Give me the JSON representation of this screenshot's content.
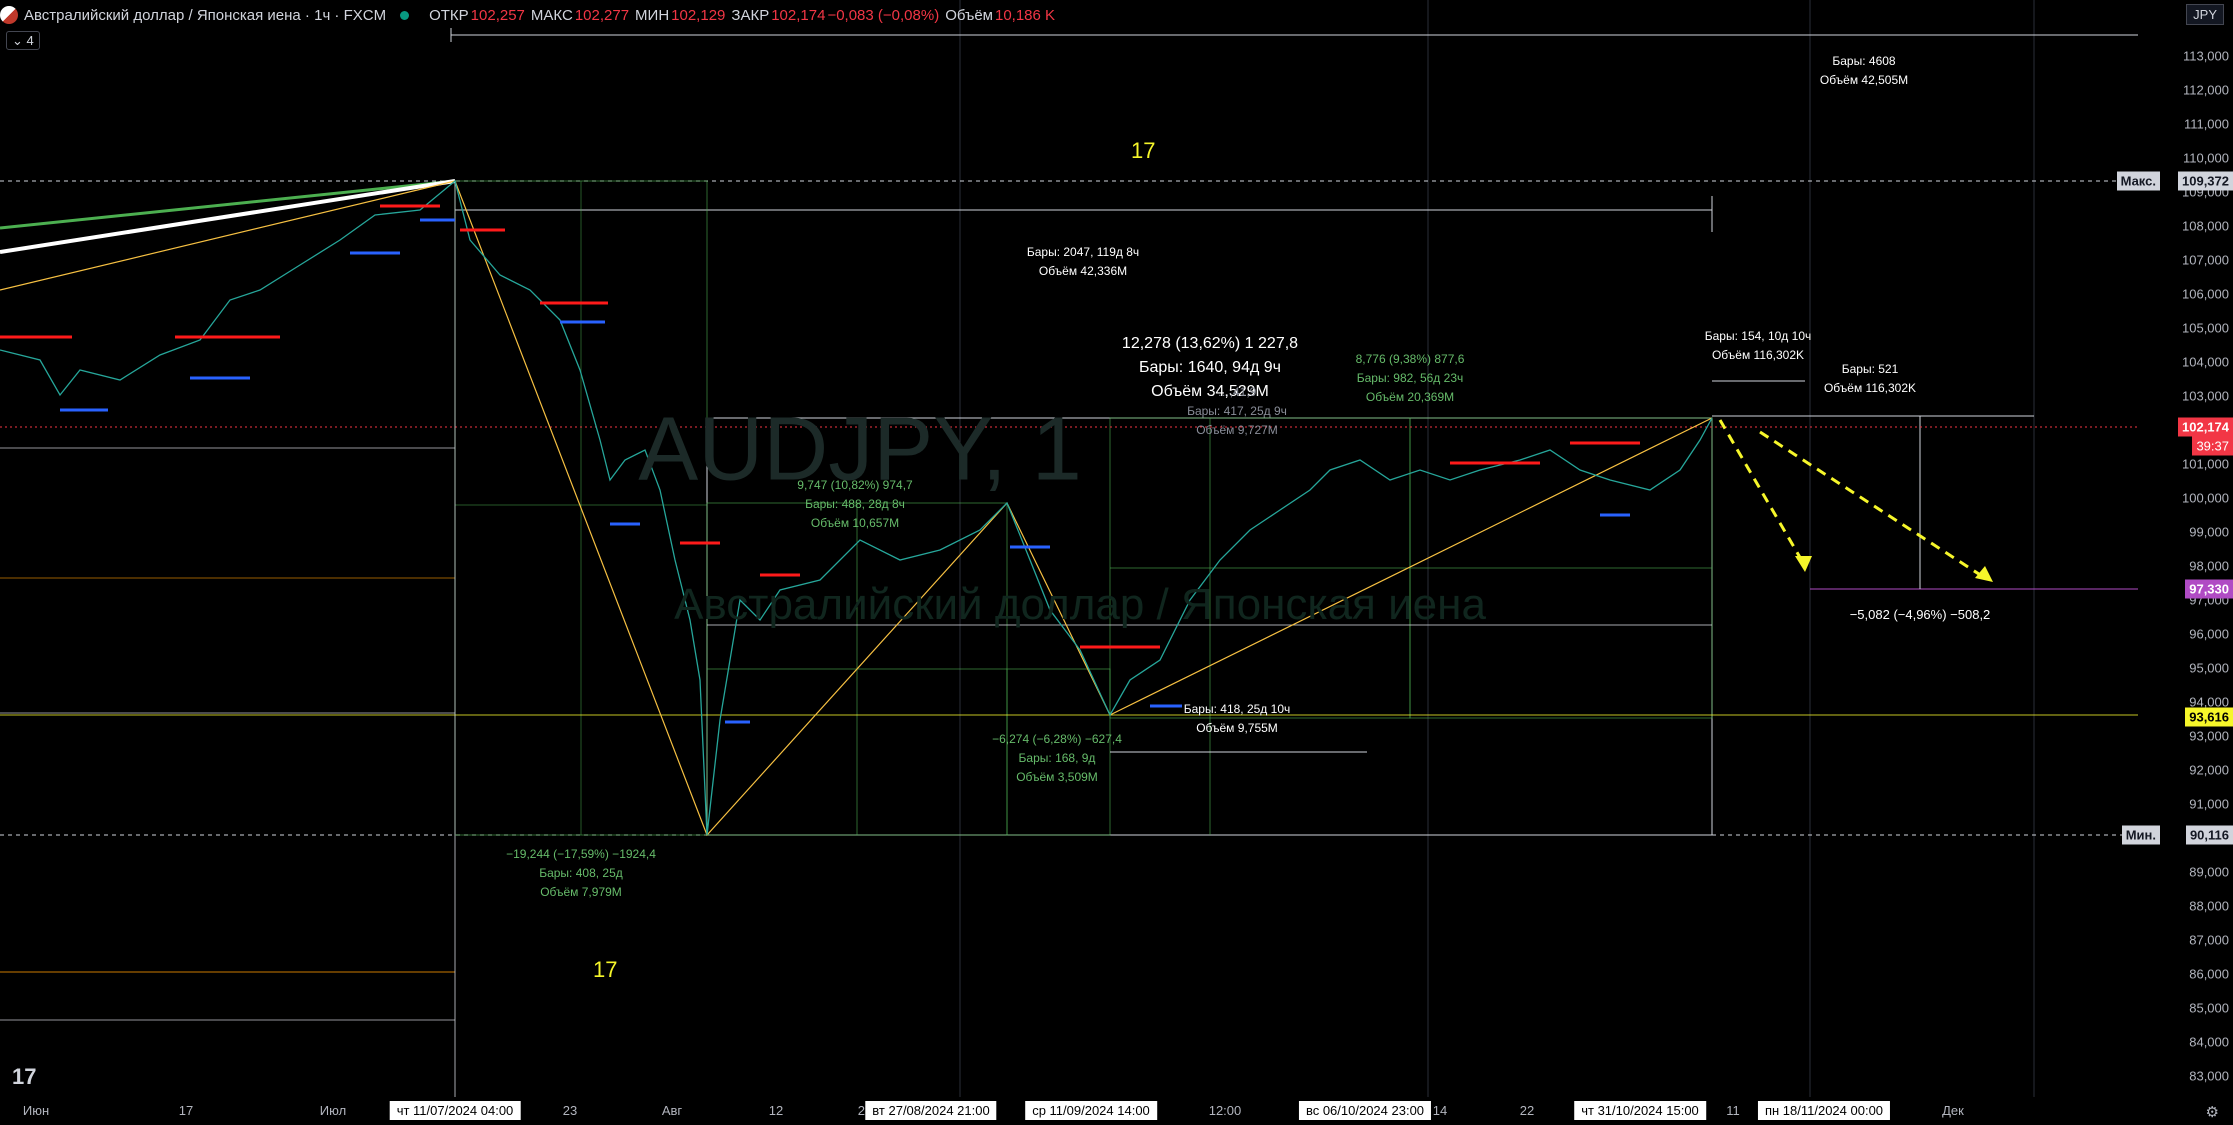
{
  "header": {
    "title": "Австралийский доллар / Японская иена · 1ч · FXCM",
    "open_label": "ОТКР",
    "open": "102,257",
    "high_label": "МАКС",
    "high": "102,277",
    "low_label": "МИН",
    "low": "102,129",
    "close_label": "ЗАКР",
    "close": "102,174",
    "change": "−0,083 (−0,08%)",
    "volume_label": "Объём",
    "volume": "10,186 K",
    "indicators_badge": "4"
  },
  "currency_button": "JPY",
  "watermark": {
    "symbol": "AUDJPY, 1",
    "name": "Австралийский доллар / Японская иена"
  },
  "price_axis": {
    "ticks": [
      "113,000",
      "112,000",
      "111,000",
      "110,000",
      "109,000",
      "108,000",
      "107,000",
      "106,000",
      "105,000",
      "104,000",
      "103,000",
      "102,000",
      "101,000",
      "100,000",
      "99,000",
      "98,000",
      "97,000",
      "96,000",
      "95,000",
      "94,000",
      "93,000",
      "92,000",
      "91,000",
      "90,000",
      "89,000",
      "88,000",
      "87,000",
      "86,000",
      "85,000",
      "84,000",
      "83,000"
    ],
    "max_label": "Макс.",
    "max_value": "109,372",
    "min_label": "Мин.",
    "min_value": "90,116",
    "current_price": "102,174",
    "countdown": "39:37",
    "target_price": "97,330",
    "support_price": "93,616"
  },
  "time_axis": {
    "ticks": [
      "Июн",
      "17",
      "Июл",
      "23",
      "Авг",
      "12",
      "20",
      "12:00",
      "14",
      "22",
      "11",
      "Дек"
    ],
    "crosshair_labels": [
      "чт 11/07/2024   04:00",
      "вт 27/08/2024   21:00",
      "ср 11/09/2024   14:00",
      "вс 06/10/2024   23:00",
      "чт 31/10/2024   15:00",
      "пн 18/11/2024   00:00"
    ]
  },
  "annotations": {
    "wave_number_top": "17",
    "wave_number_bottom": "17",
    "range_top": {
      "line1": "Бары: 4608",
      "line2": "Объём 42,505M"
    },
    "range_long": {
      "line1": "Бары: 2047, 119д 8ч",
      "line2": "Объём 42,336M"
    },
    "main_box": {
      "line1": "12,278 (13,62%) 1 227,8",
      "line2": "Бары: 1640, 94д 9ч",
      "line3": "Объём 34,529M"
    },
    "box_hidden": {
      "line1": "…,41,9",
      "line2": "Бары: 417, 25д 9ч",
      "line3": "Объём 9,727M"
    },
    "box_green_a": {
      "line1": "9,747 (10,82%) 974,7",
      "line2": "Бары: 488, 28д 8ч",
      "line3": "Объём 10,657M"
    },
    "box_green_b": {
      "line1": "8,776 (9,38%) 877,6",
      "line2": "Бары: 982, 56д 23ч",
      "line3": "Объём 20,369M"
    },
    "box_drop": {
      "line1": "−19,244 (−17,59%) −1924,4",
      "line2": "Бары: 408, 25д",
      "line3": "Объём 7,979M"
    },
    "box_small_drop": {
      "line1": "−6,274 (−6,28%) −627,4",
      "line2": "Бары: 168, 9д",
      "line3": "Объём 3,509M"
    },
    "range_mid": {
      "line1": "Бары: 418, 25д 10ч",
      "line2": "Объём 9,755M"
    },
    "range_right_a": {
      "line1": "Бары: 154, 10д 10ч",
      "line2": "Объём 116,302K"
    },
    "range_right_b": {
      "line1": "Бары: 521",
      "line2": "Объём 116,302K"
    },
    "projection": {
      "line1": "−5,082 (−4,96%) −508,2"
    }
  },
  "colors": {
    "up": "#26a69a",
    "down": "#ef5350",
    "accent_yellow": "#f6f62a",
    "pivot_red": "#ff1a1a",
    "pivot_blue": "#2962ff"
  }
}
